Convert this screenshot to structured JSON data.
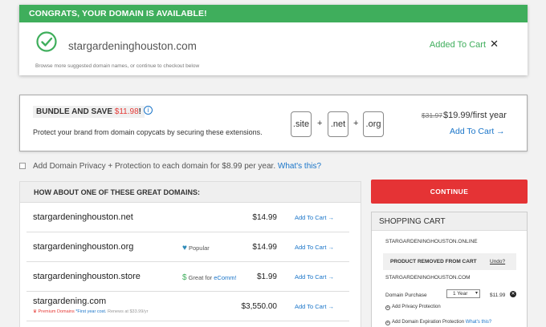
{
  "availability": {
    "banner": "CONGRATS, YOUR DOMAIN IS AVAILABLE!",
    "domain": "stargardeninghouston.com",
    "note": "Browse more suggested domain names, or continue to checkout below",
    "status": "Added To Cart",
    "close": "✕"
  },
  "bundle": {
    "heading": "BUNDLE AND SAVE",
    "heading_price": "$11.98",
    "heading_end": "!",
    "info": "i",
    "description": "Protect your brand from domain copycats by securing these extensions.",
    "tlds": [
      ".site",
      ".net",
      ".org"
    ],
    "plus": "+",
    "old_price": "$31.97",
    "new_price": "$19.99/first year",
    "add_label": "Add To Cart →"
  },
  "privacy": {
    "label": "Add Domain Privacy + Protection to each domain for $8.99 per year.",
    "link": "What's this?"
  },
  "suggestions": {
    "heading": "HOW ABOUT ONE OF THESE GREAT DOMAINS:",
    "add_label": "Add To Cart →",
    "rows": [
      {
        "name": "stargardeninghouston.net",
        "price": "$14.99"
      },
      {
        "name": "stargardeninghouston.org",
        "badge": "Popular",
        "price": "$14.99"
      },
      {
        "name": "stargardeninghouston.store",
        "badge_prefix": "Great for ",
        "badge_link": "eComm!",
        "price": "$1.99"
      },
      {
        "name": "stargardening.com",
        "price": "$3,550.00",
        "sub_premium": "Premium Domains",
        "sub_note": "First year cost.",
        "sub_renew": "Renews at $33.99/yr"
      }
    ]
  },
  "continue_label": "CONTINUE",
  "cart": {
    "heading": "SHOPPING CART",
    "item1": "STARGARDENINGHOUSTON.ONLINE",
    "removed": "PRODUCT REMOVED FROM CART",
    "undo": "Undo?",
    "item2": "STARGARDENINGHOUSTON.COM",
    "purchase_label": "Domain Purchase",
    "term": "1 Year",
    "purchase_price": "$11.99",
    "opt_privacy": "Add Privacy Protection",
    "opt_expiry": "Add Domain Expiration Protection",
    "opt_expiry_link": "What's this?"
  },
  "colors": {
    "success": "#3fae5c",
    "accent": "#1a75c9",
    "danger": "#e53335"
  }
}
